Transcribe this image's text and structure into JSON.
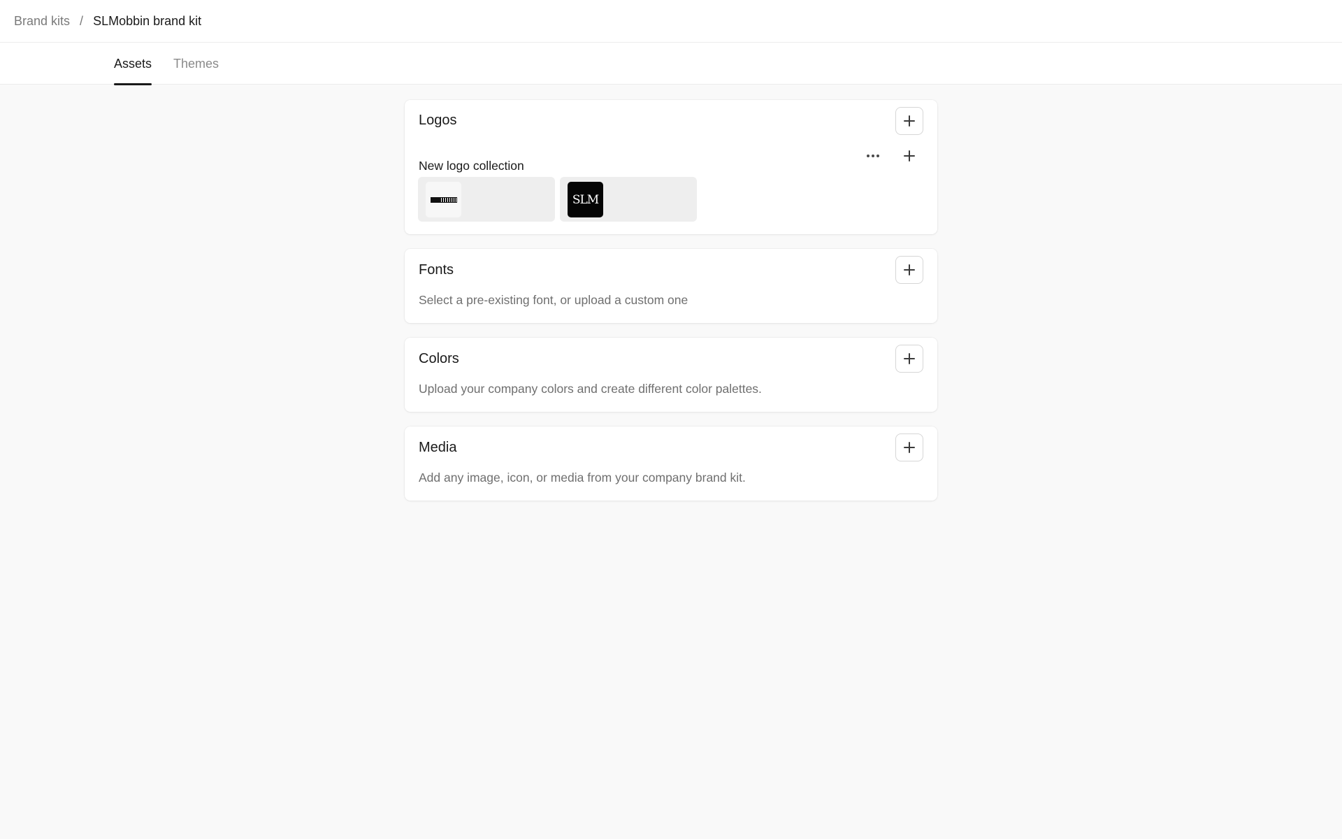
{
  "breadcrumb": {
    "parent": "Brand kits",
    "separator": "/",
    "current": "SLMobbin brand kit"
  },
  "tabs": [
    {
      "label": "Assets",
      "active": true
    },
    {
      "label": "Themes",
      "active": false
    }
  ],
  "sections": {
    "logos": {
      "title": "Logos",
      "collection": {
        "name": "New logo collection",
        "items": [
          {
            "name": "SLMobbin horizontal wordmark",
            "background": "#f7f7f7"
          },
          {
            "name": "SLM monogram",
            "text": "SLM",
            "background": "#050505"
          }
        ]
      }
    },
    "fonts": {
      "title": "Fonts",
      "description": "Select a pre-existing font, or upload a custom one"
    },
    "colors": {
      "title": "Colors",
      "description": "Upload your company colors and create different color palettes."
    },
    "media": {
      "title": "Media",
      "description": "Add any image, icon, or media from your company brand kit."
    }
  },
  "icons": {
    "add": "plus-icon",
    "more": "more-horizontal-icon"
  },
  "colors": {
    "page_background": "#f9f9f9",
    "card_background": "#ffffff",
    "muted_text": "#6f6f6f",
    "active_tab_underline": "#1a1a1a"
  }
}
